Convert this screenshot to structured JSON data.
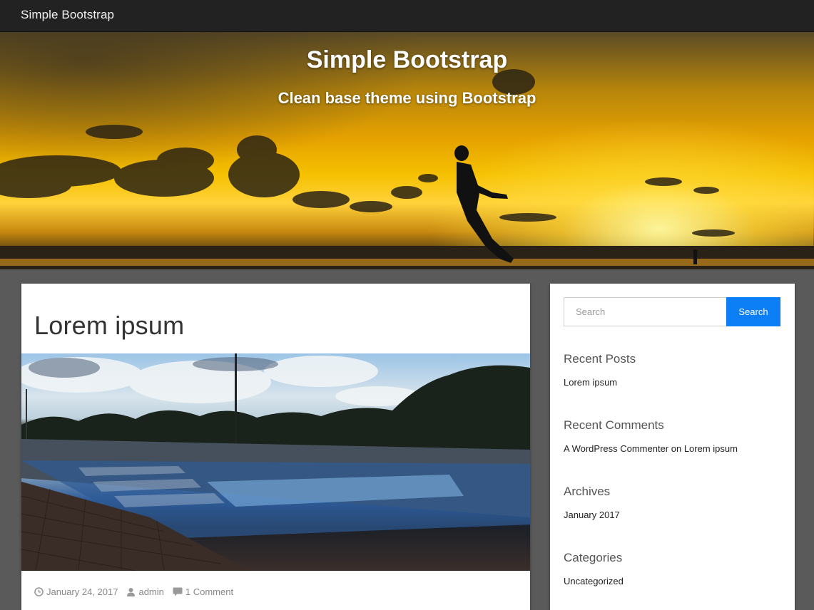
{
  "navbar": {
    "brand": "Simple Bootstrap"
  },
  "hero": {
    "title": "Simple Bootstrap",
    "tagline": "Clean base theme using Bootstrap"
  },
  "post": {
    "title": "Lorem ipsum",
    "meta": {
      "date": "January 24, 2017",
      "author": "admin",
      "comments": "1 Comment",
      "date_icon": "clock-icon",
      "author_icon": "user-icon",
      "comments_icon": "comment-icon"
    }
  },
  "sidebar": {
    "search": {
      "placeholder": "Search",
      "button_label": "Search",
      "button_color": "#0d7ff6"
    },
    "widgets": [
      {
        "title": "Recent Posts",
        "items": [
          "Lorem ipsum"
        ]
      },
      {
        "title": "Recent Comments",
        "items": [
          "A WordPress Commenter on Lorem ipsum"
        ]
      },
      {
        "title": "Archives",
        "items": [
          "January 2017"
        ]
      },
      {
        "title": "Categories",
        "items": [
          "Uncategorized"
        ]
      }
    ]
  }
}
